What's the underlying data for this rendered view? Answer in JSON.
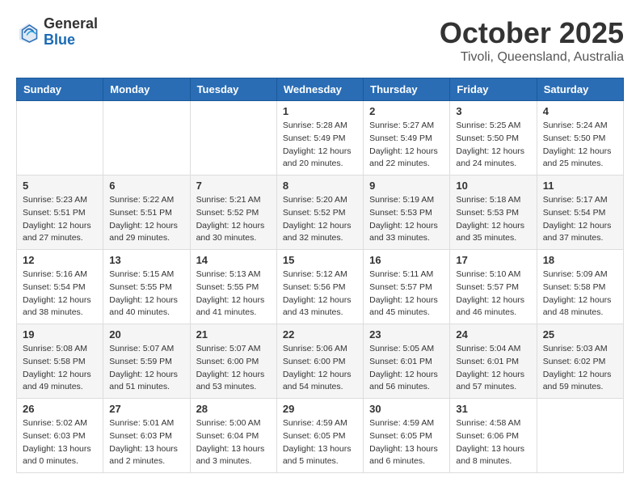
{
  "logo": {
    "general": "General",
    "blue": "Blue"
  },
  "header": {
    "month": "October 2025",
    "location": "Tivoli, Queensland, Australia"
  },
  "weekdays": [
    "Sunday",
    "Monday",
    "Tuesday",
    "Wednesday",
    "Thursday",
    "Friday",
    "Saturday"
  ],
  "weeks": [
    [
      {
        "day": "",
        "sunrise": "",
        "sunset": "",
        "daylight": ""
      },
      {
        "day": "",
        "sunrise": "",
        "sunset": "",
        "daylight": ""
      },
      {
        "day": "",
        "sunrise": "",
        "sunset": "",
        "daylight": ""
      },
      {
        "day": "1",
        "sunrise": "Sunrise: 5:28 AM",
        "sunset": "Sunset: 5:49 PM",
        "daylight": "Daylight: 12 hours and 20 minutes."
      },
      {
        "day": "2",
        "sunrise": "Sunrise: 5:27 AM",
        "sunset": "Sunset: 5:49 PM",
        "daylight": "Daylight: 12 hours and 22 minutes."
      },
      {
        "day": "3",
        "sunrise": "Sunrise: 5:25 AM",
        "sunset": "Sunset: 5:50 PM",
        "daylight": "Daylight: 12 hours and 24 minutes."
      },
      {
        "day": "4",
        "sunrise": "Sunrise: 5:24 AM",
        "sunset": "Sunset: 5:50 PM",
        "daylight": "Daylight: 12 hours and 25 minutes."
      }
    ],
    [
      {
        "day": "5",
        "sunrise": "Sunrise: 5:23 AM",
        "sunset": "Sunset: 5:51 PM",
        "daylight": "Daylight: 12 hours and 27 minutes."
      },
      {
        "day": "6",
        "sunrise": "Sunrise: 5:22 AM",
        "sunset": "Sunset: 5:51 PM",
        "daylight": "Daylight: 12 hours and 29 minutes."
      },
      {
        "day": "7",
        "sunrise": "Sunrise: 5:21 AM",
        "sunset": "Sunset: 5:52 PM",
        "daylight": "Daylight: 12 hours and 30 minutes."
      },
      {
        "day": "8",
        "sunrise": "Sunrise: 5:20 AM",
        "sunset": "Sunset: 5:52 PM",
        "daylight": "Daylight: 12 hours and 32 minutes."
      },
      {
        "day": "9",
        "sunrise": "Sunrise: 5:19 AM",
        "sunset": "Sunset: 5:53 PM",
        "daylight": "Daylight: 12 hours and 33 minutes."
      },
      {
        "day": "10",
        "sunrise": "Sunrise: 5:18 AM",
        "sunset": "Sunset: 5:53 PM",
        "daylight": "Daylight: 12 hours and 35 minutes."
      },
      {
        "day": "11",
        "sunrise": "Sunrise: 5:17 AM",
        "sunset": "Sunset: 5:54 PM",
        "daylight": "Daylight: 12 hours and 37 minutes."
      }
    ],
    [
      {
        "day": "12",
        "sunrise": "Sunrise: 5:16 AM",
        "sunset": "Sunset: 5:54 PM",
        "daylight": "Daylight: 12 hours and 38 minutes."
      },
      {
        "day": "13",
        "sunrise": "Sunrise: 5:15 AM",
        "sunset": "Sunset: 5:55 PM",
        "daylight": "Daylight: 12 hours and 40 minutes."
      },
      {
        "day": "14",
        "sunrise": "Sunrise: 5:13 AM",
        "sunset": "Sunset: 5:55 PM",
        "daylight": "Daylight: 12 hours and 41 minutes."
      },
      {
        "day": "15",
        "sunrise": "Sunrise: 5:12 AM",
        "sunset": "Sunset: 5:56 PM",
        "daylight": "Daylight: 12 hours and 43 minutes."
      },
      {
        "day": "16",
        "sunrise": "Sunrise: 5:11 AM",
        "sunset": "Sunset: 5:57 PM",
        "daylight": "Daylight: 12 hours and 45 minutes."
      },
      {
        "day": "17",
        "sunrise": "Sunrise: 5:10 AM",
        "sunset": "Sunset: 5:57 PM",
        "daylight": "Daylight: 12 hours and 46 minutes."
      },
      {
        "day": "18",
        "sunrise": "Sunrise: 5:09 AM",
        "sunset": "Sunset: 5:58 PM",
        "daylight": "Daylight: 12 hours and 48 minutes."
      }
    ],
    [
      {
        "day": "19",
        "sunrise": "Sunrise: 5:08 AM",
        "sunset": "Sunset: 5:58 PM",
        "daylight": "Daylight: 12 hours and 49 minutes."
      },
      {
        "day": "20",
        "sunrise": "Sunrise: 5:07 AM",
        "sunset": "Sunset: 5:59 PM",
        "daylight": "Daylight: 12 hours and 51 minutes."
      },
      {
        "day": "21",
        "sunrise": "Sunrise: 5:07 AM",
        "sunset": "Sunset: 6:00 PM",
        "daylight": "Daylight: 12 hours and 53 minutes."
      },
      {
        "day": "22",
        "sunrise": "Sunrise: 5:06 AM",
        "sunset": "Sunset: 6:00 PM",
        "daylight": "Daylight: 12 hours and 54 minutes."
      },
      {
        "day": "23",
        "sunrise": "Sunrise: 5:05 AM",
        "sunset": "Sunset: 6:01 PM",
        "daylight": "Daylight: 12 hours and 56 minutes."
      },
      {
        "day": "24",
        "sunrise": "Sunrise: 5:04 AM",
        "sunset": "Sunset: 6:01 PM",
        "daylight": "Daylight: 12 hours and 57 minutes."
      },
      {
        "day": "25",
        "sunrise": "Sunrise: 5:03 AM",
        "sunset": "Sunset: 6:02 PM",
        "daylight": "Daylight: 12 hours and 59 minutes."
      }
    ],
    [
      {
        "day": "26",
        "sunrise": "Sunrise: 5:02 AM",
        "sunset": "Sunset: 6:03 PM",
        "daylight": "Daylight: 13 hours and 0 minutes."
      },
      {
        "day": "27",
        "sunrise": "Sunrise: 5:01 AM",
        "sunset": "Sunset: 6:03 PM",
        "daylight": "Daylight: 13 hours and 2 minutes."
      },
      {
        "day": "28",
        "sunrise": "Sunrise: 5:00 AM",
        "sunset": "Sunset: 6:04 PM",
        "daylight": "Daylight: 13 hours and 3 minutes."
      },
      {
        "day": "29",
        "sunrise": "Sunrise: 4:59 AM",
        "sunset": "Sunset: 6:05 PM",
        "daylight": "Daylight: 13 hours and 5 minutes."
      },
      {
        "day": "30",
        "sunrise": "Sunrise: 4:59 AM",
        "sunset": "Sunset: 6:05 PM",
        "daylight": "Daylight: 13 hours and 6 minutes."
      },
      {
        "day": "31",
        "sunrise": "Sunrise: 4:58 AM",
        "sunset": "Sunset: 6:06 PM",
        "daylight": "Daylight: 13 hours and 8 minutes."
      },
      {
        "day": "",
        "sunrise": "",
        "sunset": "",
        "daylight": ""
      }
    ]
  ]
}
